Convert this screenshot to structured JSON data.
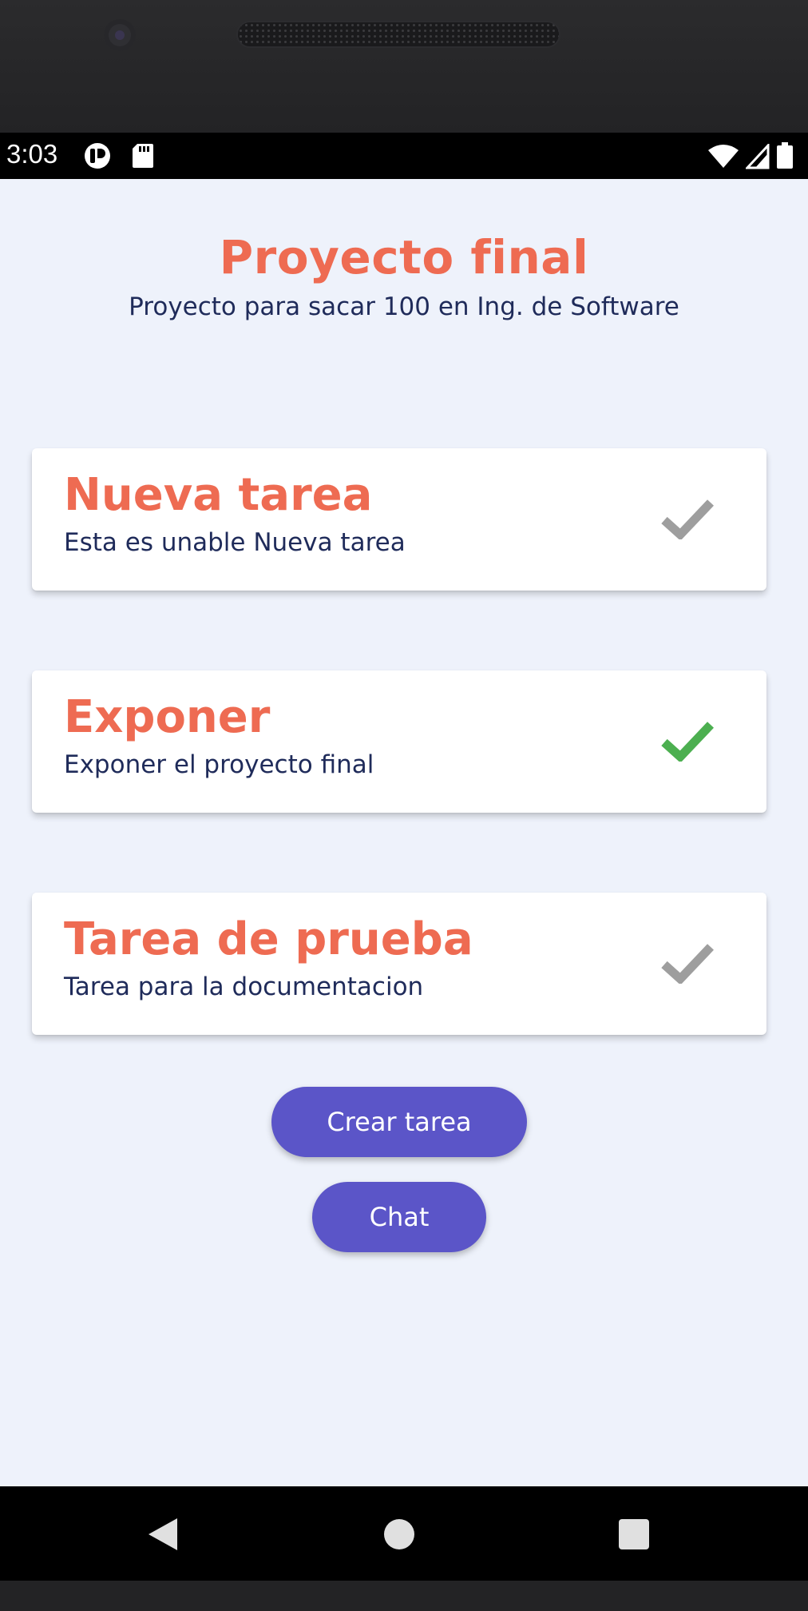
{
  "status_bar": {
    "time": "3:03"
  },
  "header": {
    "title": "Proyecto final",
    "subtitle": "Proyecto para sacar 100 en Ing. de Software"
  },
  "tasks": [
    {
      "title": "Nueva tarea",
      "description": "Esta es unable Nueva tarea",
      "completed": false,
      "check_color": "#9e9e9e"
    },
    {
      "title": "Exponer",
      "description": "Exponer el proyecto final",
      "completed": true,
      "check_color": "#4caf50"
    },
    {
      "title": "Tarea de prueba",
      "description": "Tarea para la documentacion",
      "completed": false,
      "check_color": "#9e9e9e"
    }
  ],
  "actions": {
    "create_task_label": "Crear tarea",
    "chat_label": "Chat"
  },
  "colors": {
    "accent": "#ee6b52",
    "text_dark": "#1f2b5a",
    "button": "#5b55c8",
    "background": "#eef2fb"
  },
  "nav_bar": {
    "back_icon": "back-triangle-icon",
    "home_icon": "home-circle-icon",
    "recents_icon": "recents-square-icon"
  }
}
